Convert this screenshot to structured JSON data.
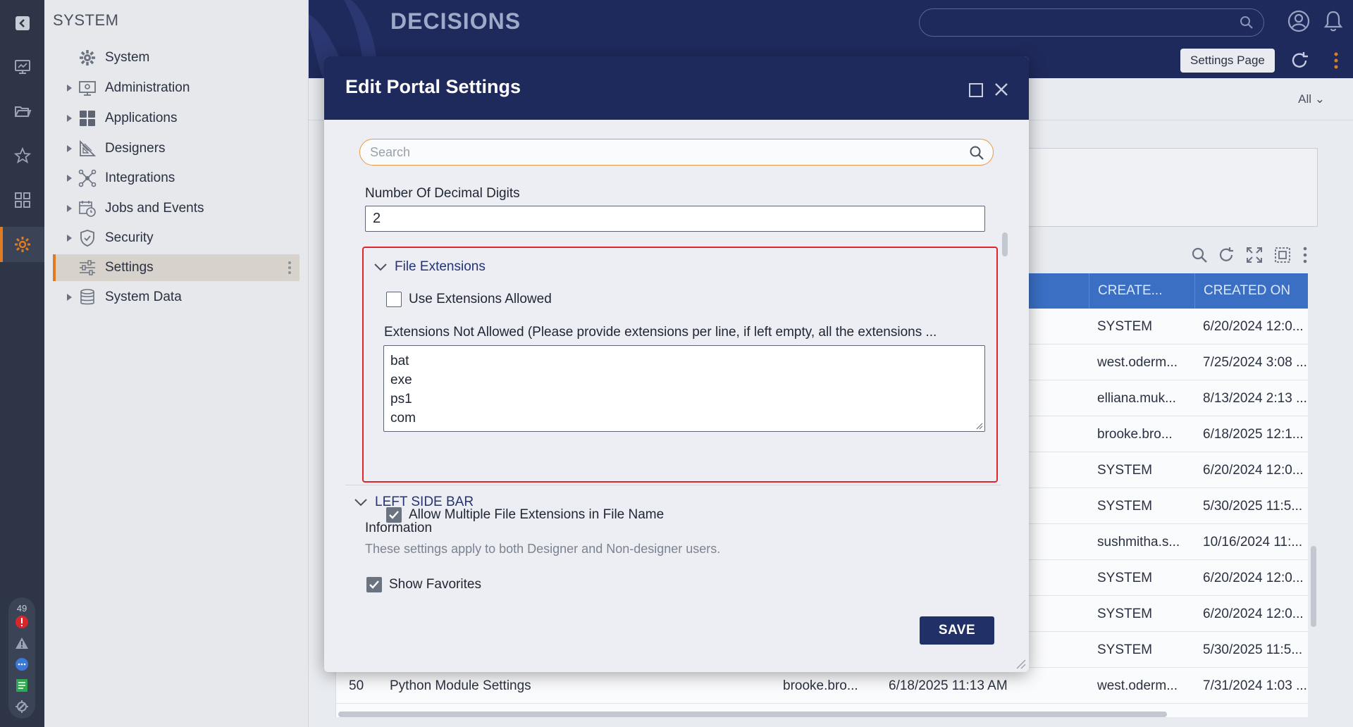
{
  "app": {
    "brand": "DECISIONS",
    "settings_page_label": "Settings Page",
    "all_filter": "All"
  },
  "sidebar": {
    "title": "SYSTEM",
    "items": [
      {
        "label": "System",
        "icon": "gear-icon",
        "expandable": false
      },
      {
        "label": "Administration",
        "icon": "monitor-icon",
        "expandable": true
      },
      {
        "label": "Applications",
        "icon": "grid-icon",
        "expandable": true
      },
      {
        "label": "Designers",
        "icon": "ruler-icon",
        "expandable": true
      },
      {
        "label": "Integrations",
        "icon": "network-icon",
        "expandable": true
      },
      {
        "label": "Jobs and Events",
        "icon": "calendar-clock-icon",
        "expandable": true
      },
      {
        "label": "Security",
        "icon": "shield-icon",
        "expandable": true
      },
      {
        "label": "Settings",
        "icon": "sliders-icon",
        "expandable": false,
        "selected": true
      },
      {
        "label": "System Data",
        "icon": "database-icon",
        "expandable": true
      }
    ]
  },
  "rail": {
    "notification_count": "49"
  },
  "grid": {
    "columns": [
      "CREATE...",
      "CREATED ON"
    ],
    "rows": [
      {
        "created_by": "SYSTEM",
        "created_on": "6/20/2024 12:0..."
      },
      {
        "created_by": "west.oderm...",
        "created_on": "7/25/2024 3:08 ..."
      },
      {
        "created_by": "elliana.muk...",
        "created_on": "8/13/2024 2:13 ..."
      },
      {
        "created_by": "brooke.bro...",
        "created_on": "6/18/2025 12:1..."
      },
      {
        "created_by": "SYSTEM",
        "created_on": "6/20/2024 12:0..."
      },
      {
        "created_by": "SYSTEM",
        "created_on": "5/30/2025 11:5..."
      },
      {
        "created_by": "sushmitha.s...",
        "created_on": "10/16/2024 11:..."
      },
      {
        "created_by": "SYSTEM",
        "created_on": "6/20/2024 12:0..."
      },
      {
        "created_by": "SYSTEM",
        "created_on": "6/20/2024 12:0..."
      },
      {
        "created_by": "SYSTEM",
        "created_on": "5/30/2025 11:5..."
      }
    ],
    "last_row": {
      "num": "50",
      "name": "Python Module Settings",
      "modified_by": "brooke.bro...",
      "modified_on": "6/18/2025 11:13 AM",
      "created_by": "west.oderm...",
      "created_on": "7/31/2024 1:03 ..."
    }
  },
  "modal": {
    "title": "Edit Portal Settings",
    "search_placeholder": "Search",
    "decimal_label": "Number Of Decimal Digits",
    "decimal_value": "2",
    "file_extensions": {
      "header": "File Extensions",
      "use_allowed_label": "Use Extensions Allowed",
      "use_allowed_checked": false,
      "not_allowed_label": "Extensions Not Allowed (Please provide extensions per line, if left empty, all the extensions ...",
      "not_allowed_values": [
        "bat",
        "exe",
        "ps1",
        "com"
      ],
      "allow_multiple_label": "Allow Multiple File Extensions in File Name",
      "allow_multiple_checked": true
    },
    "left_side_bar": {
      "header": "LEFT SIDE BAR",
      "info_label": "Information",
      "info_text": "These settings apply to both Designer and Non-designer users.",
      "show_favorites_label": "Show Favorites",
      "show_favorites_checked": true
    },
    "save_label": "SAVE"
  },
  "colors": {
    "header_navy": "#1f2a5c",
    "accent_orange": "#e07b22",
    "highlight_red": "#e0262a",
    "grid_header_blue": "#3a6fc4"
  }
}
